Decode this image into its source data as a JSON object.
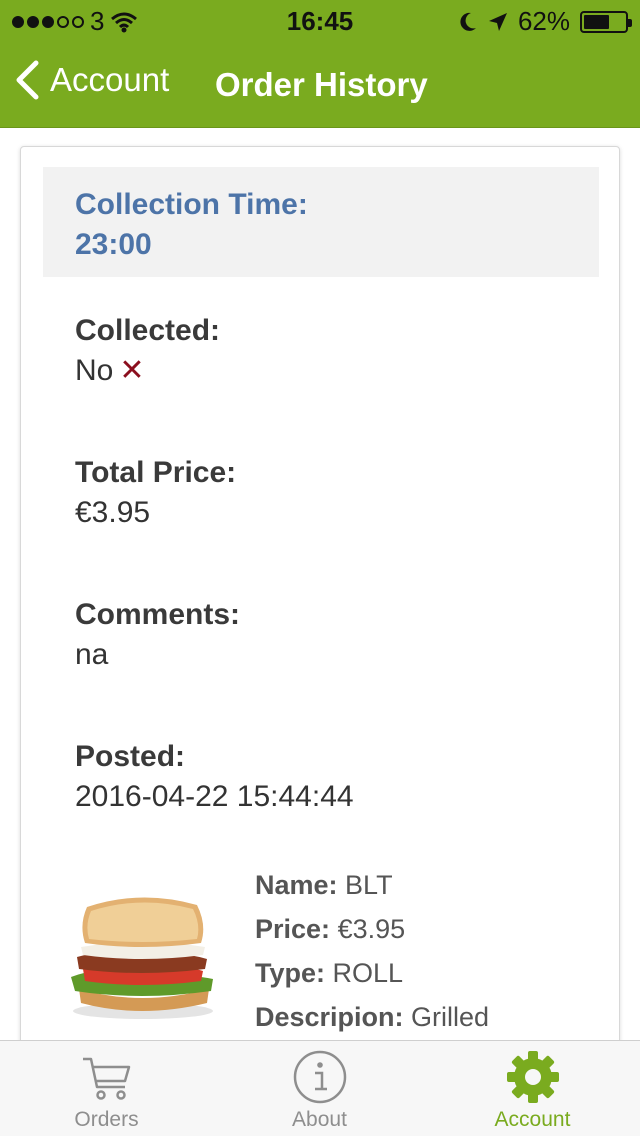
{
  "status_bar": {
    "carrier": "3",
    "time": "16:45",
    "battery": "62%",
    "battery_level": 0.62
  },
  "nav": {
    "back_label": "Account",
    "title": "Order History"
  },
  "order": {
    "collection_label": "Collection Time:",
    "collection_value": "23:00",
    "collected_label": "Collected:",
    "collected_value": "No",
    "collected_mark": "✕",
    "total_label": "Total Price:",
    "total_value": "€3.95",
    "comments_label": "Comments:",
    "comments_value": "na",
    "posted_label": "Posted:",
    "posted_value": "2016-04-22 15:44:44"
  },
  "item": {
    "name_label": "Name:",
    "name_value": "BLT",
    "price_label": "Price:",
    "price_value": "€3.95",
    "type_label": "Type:",
    "type_value": "ROLL",
    "desc_label": "Descripion:",
    "desc_value": "Grilled"
  },
  "tabs": [
    {
      "label": "Orders",
      "icon": "cart-icon",
      "active": false
    },
    {
      "label": "About",
      "icon": "info-icon",
      "active": false
    },
    {
      "label": "Account",
      "icon": "gear-icon",
      "active": true
    }
  ],
  "colors": {
    "brand_green": "#7aab1f",
    "link_blue": "#4d74a8",
    "error_red": "#8b0f1e",
    "tab_inactive": "#8e8e8e"
  }
}
